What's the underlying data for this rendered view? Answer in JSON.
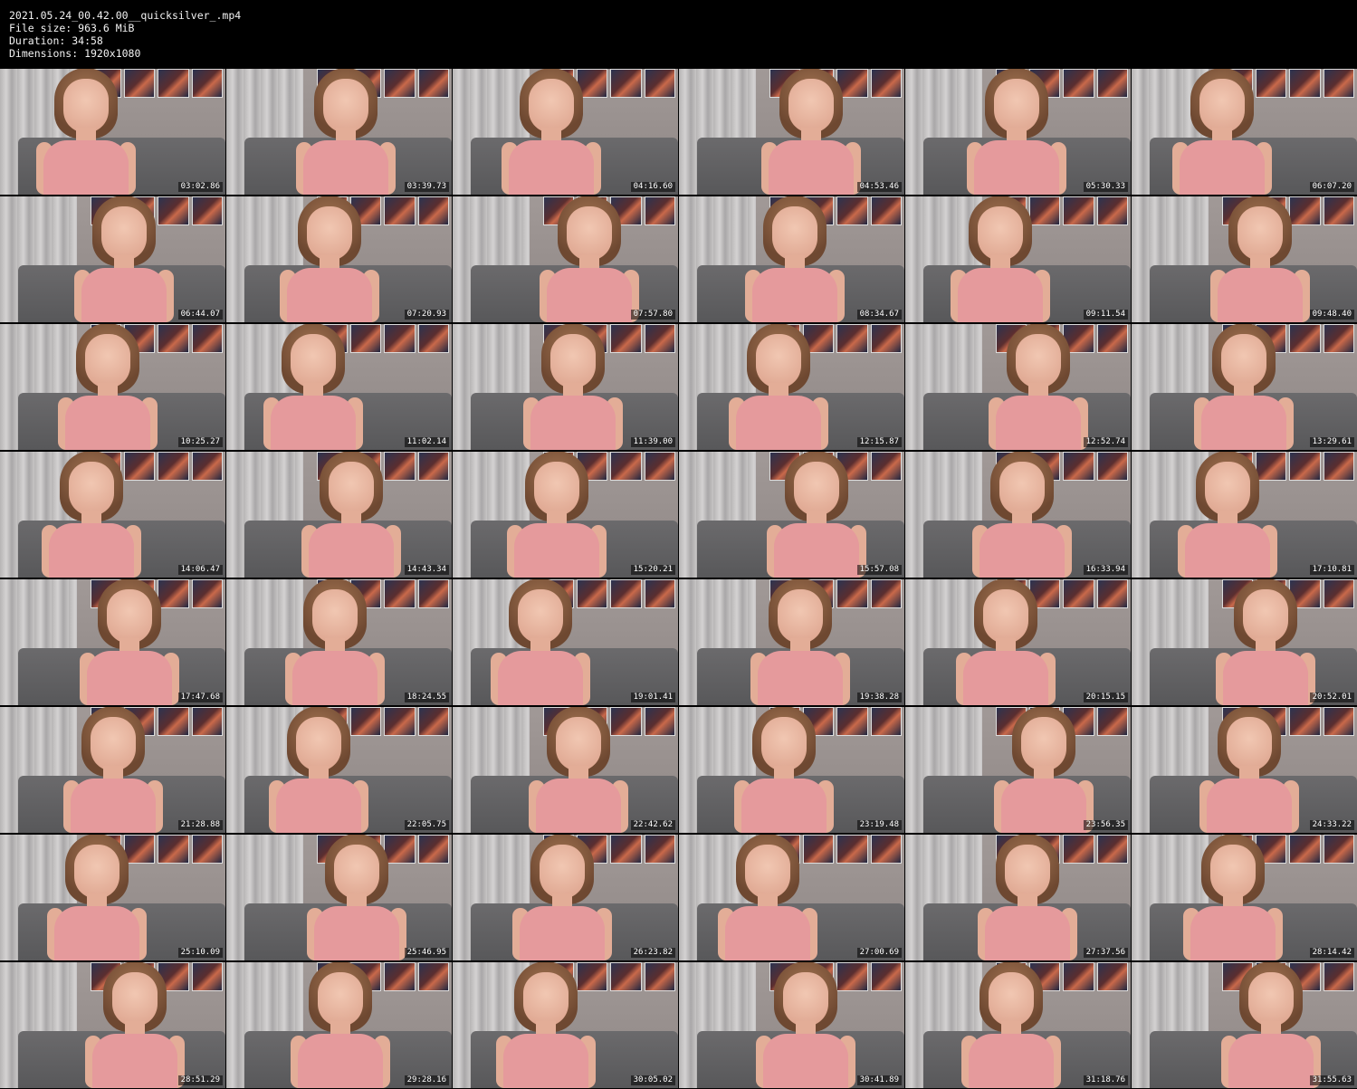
{
  "header": {
    "filename": "2021.05.24_00.42.00__quicksilver_.mp4",
    "file_size_label": "File size: 963.6 MiB",
    "duration_label": "Duration: 34:58",
    "dimensions_label": "Dimensions: 1920x1080"
  },
  "thumbnails": [
    {
      "timestamp": "03:02.86"
    },
    {
      "timestamp": "03:39.73"
    },
    {
      "timestamp": "04:16.60"
    },
    {
      "timestamp": "04:53.46"
    },
    {
      "timestamp": "05:30.33"
    },
    {
      "timestamp": "06:07.20"
    },
    {
      "timestamp": "06:44.07"
    },
    {
      "timestamp": "07:20.93"
    },
    {
      "timestamp": "07:57.80"
    },
    {
      "timestamp": "08:34.67"
    },
    {
      "timestamp": "09:11.54"
    },
    {
      "timestamp": "09:48.40"
    },
    {
      "timestamp": "10:25.27"
    },
    {
      "timestamp": "11:02.14"
    },
    {
      "timestamp": "11:39.00"
    },
    {
      "timestamp": "12:15.87"
    },
    {
      "timestamp": "12:52.74"
    },
    {
      "timestamp": "13:29.61"
    },
    {
      "timestamp": "14:06.47"
    },
    {
      "timestamp": "14:43.34"
    },
    {
      "timestamp": "15:20.21"
    },
    {
      "timestamp": "15:57.08"
    },
    {
      "timestamp": "16:33.94"
    },
    {
      "timestamp": "17:10.81"
    },
    {
      "timestamp": "17:47.68"
    },
    {
      "timestamp": "18:24.55"
    },
    {
      "timestamp": "19:01.41"
    },
    {
      "timestamp": "19:38.28"
    },
    {
      "timestamp": "20:15.15"
    },
    {
      "timestamp": "20:52.01"
    },
    {
      "timestamp": "21:28.88"
    },
    {
      "timestamp": "22:05.75"
    },
    {
      "timestamp": "22:42.62"
    },
    {
      "timestamp": "23:19.48"
    },
    {
      "timestamp": "23:56.35"
    },
    {
      "timestamp": "24:33.22"
    },
    {
      "timestamp": "25:10.09"
    },
    {
      "timestamp": "25:46.95"
    },
    {
      "timestamp": "26:23.82"
    },
    {
      "timestamp": "27:00.69"
    },
    {
      "timestamp": "27:37.56"
    },
    {
      "timestamp": "28:14.42"
    },
    {
      "timestamp": "28:51.29"
    },
    {
      "timestamp": "29:28.16"
    },
    {
      "timestamp": "30:05.02"
    },
    {
      "timestamp": "30:41.89"
    },
    {
      "timestamp": "31:18.76"
    },
    {
      "timestamp": "31:55.63"
    }
  ]
}
